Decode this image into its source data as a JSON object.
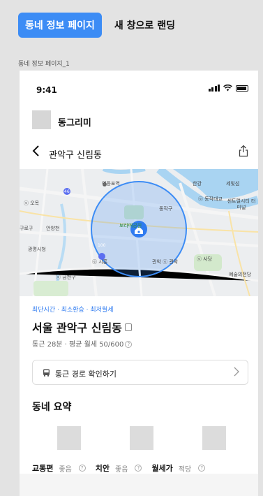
{
  "top_tabs": {
    "active": "동네 정보 페이지",
    "other": "새 창으로 랜딩"
  },
  "frame_label": "동네 정보 페이지_1",
  "status_bar": {
    "time": "9:41"
  },
  "app": {
    "name": "동그리미"
  },
  "nav": {
    "back_icon": "chevron-left-icon",
    "title": "관악구 신림동",
    "share_icon": "share-icon"
  },
  "map": {
    "labels": {
      "yeongdeungpo": "영등포역",
      "hangang": "한강",
      "sebit": "세빛섬",
      "odong": "ⓔ 오목",
      "guro": "구로구",
      "yangcheon": "안양천",
      "dongjak": "동작구",
      "boramae": "보라매공원",
      "gwangmyeong": "광명시청",
      "sihyeong": "ⓔ 시흥",
      "geumcheon": "ⓔ 금천구",
      "gwanak": "관악 ⓔ 관악",
      "sadang": "ⓔ 사당",
      "centralcity": "센트럴시티 터미널",
      "arts": "예술의전당",
      "dongjakdaegyo": "ⓔ 동작대교",
      "road46": "46",
      "road100": "100"
    },
    "accent": "#3c8cf5"
  },
  "summary": {
    "tags": "최단시간 · 최소환승 · 최저월세",
    "place": "서울 관악구 신림동",
    "info": "통근 28분 · 평균 월세 50/600",
    "route_button": "통근 경로 확인하기",
    "section_title": "동네 요약",
    "metrics": [
      {
        "name": "교통편",
        "value": "좋음"
      },
      {
        "name": "치안",
        "value": "좋음"
      },
      {
        "name": "월세가",
        "value": "적당"
      }
    ]
  }
}
